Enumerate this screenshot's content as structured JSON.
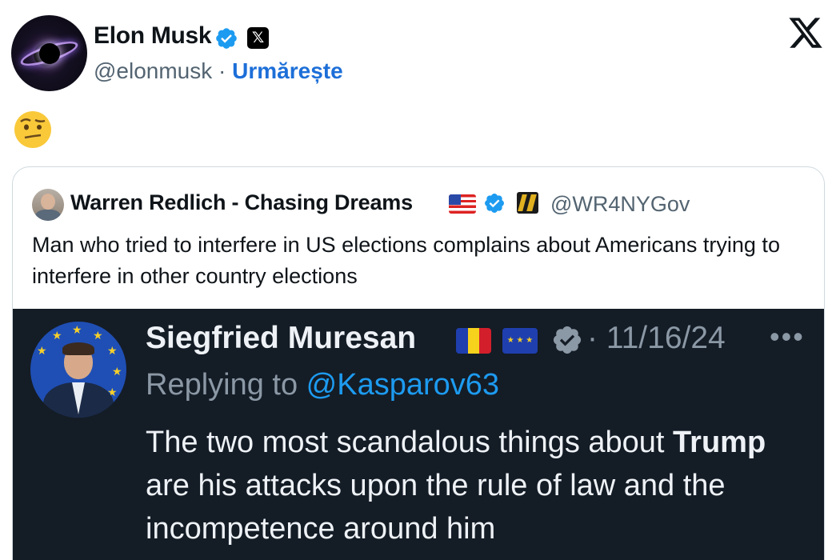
{
  "tweet": {
    "author_name": "Elon Musk",
    "author_handle": "@elonmusk",
    "separator": "·",
    "follow_label": "Urmărește",
    "x_badge_glyph": "𝕏",
    "body_emoji_icon": "face-with-raised-eyebrow-icon",
    "brand_icon": "x-logo-icon",
    "verified_color": "#1d9bf0"
  },
  "quote": {
    "author_name": "Warren Redlich - Chasing Dreams",
    "author_handle": "@WR4NYGov",
    "text": "Man who tried to interfere in US elections complains about Americans trying to interfere in other country elections",
    "flag_icon": "us-flag-icon",
    "affiliation_icon": "affiliate-badge-icon"
  },
  "embedded": {
    "author_name": "Siegfried Muresan",
    "separator_date": "· 11/16/24",
    "more_glyph": "•••",
    "reply_prefix": "Replying to ",
    "reply_mention": "@Kasparov63",
    "text_before": "The two most scandalous things about ",
    "text_bold": "Trump",
    "text_after": " are his attacks upon the rule of law and the incompetence around him",
    "flags": [
      "romania-flag-icon",
      "eu-flag-icon"
    ],
    "background_color": "#141c26"
  }
}
